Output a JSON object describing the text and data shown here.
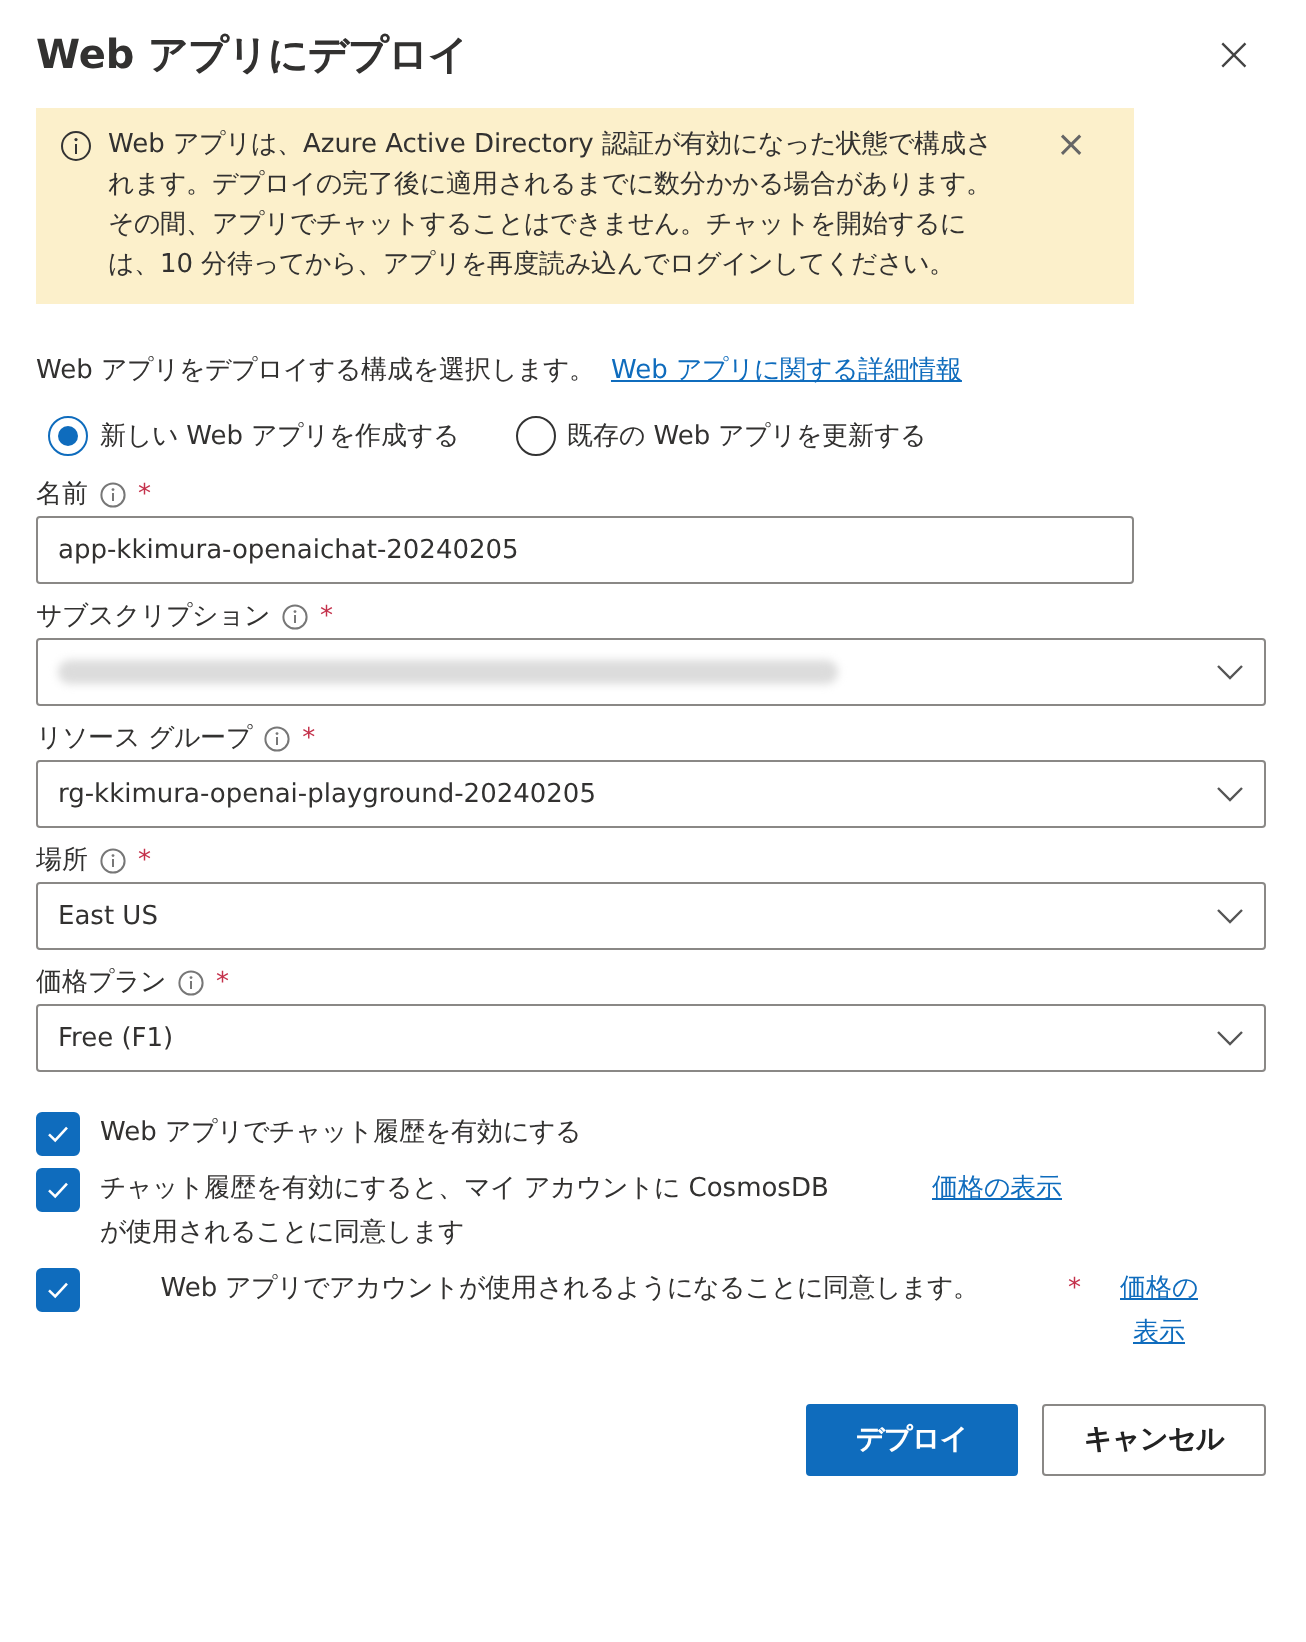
{
  "dialog": {
    "title": "Web アプリにデプロイ",
    "close_label": "×"
  },
  "banner": {
    "text": "Web アプリは、Azure Active Directory 認証が有効になった状態で構成されます。デプロイの完了後に適用されるまでに数分かかる場合があります。その間、アプリでチャットすることはできません。チャットを開始するには、10 分待ってから、アプリを再度読み込んでログインしてください。",
    "dismiss_label": "×"
  },
  "intro": {
    "text": "Web アプリをデプロイする構成を選択します。",
    "link": "Web アプリに関する詳細情報"
  },
  "mode_options": [
    {
      "label": "新しい Web アプリを作成する",
      "selected": true
    },
    {
      "label": "既存の Web アプリを更新する",
      "selected": false
    }
  ],
  "fields": [
    {
      "kind": "text",
      "label": "名前",
      "required_mark": "*",
      "value": "app-kkimura-openaichat-20240205"
    },
    {
      "kind": "dropdown",
      "label": "サブスクリプション",
      "required_mark": "*",
      "redacted": true
    },
    {
      "kind": "dropdown",
      "label": "リソース グループ",
      "required_mark": "*",
      "value": "rg-kkimura-openai-playground-20240205"
    },
    {
      "kind": "dropdown",
      "label": "場所",
      "required_mark": "*",
      "value": "East US"
    },
    {
      "kind": "dropdown",
      "label": "価格プラン",
      "required_mark": "*",
      "value": "Free (F1)"
    }
  ],
  "checkboxes": [
    {
      "kind": "plain",
      "label": "Web アプリでチャット履歴を有効にする",
      "checked": true
    },
    {
      "kind": "link",
      "label": "チャット履歴を有効にすると、マイ アカウントに CosmosDB が使用されることに同意します",
      "checked": true,
      "link": "価格の表示"
    },
    {
      "kind": "required_link",
      "label": "Web アプリでアカウントが使用されるようになることに同意します。",
      "checked": true,
      "required_mark": "*",
      "link": "価格の表示"
    }
  ],
  "buttons": [
    {
      "label": "デプロイ",
      "primary": true
    },
    {
      "label": "キャンセル",
      "primary": false
    }
  ]
}
